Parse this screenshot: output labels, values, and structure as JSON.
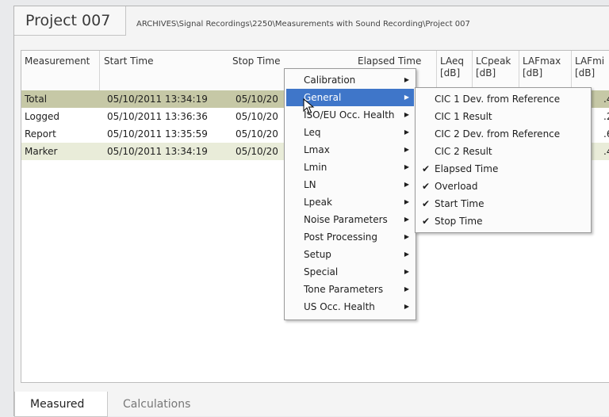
{
  "project": {
    "title": "Project 007",
    "path": "ARCHIVES\\Signal Recordings\\2250\\Measurements with Sound Recording\\Project 007"
  },
  "columns": [
    {
      "label": "Measurement",
      "unit": ""
    },
    {
      "label": "Start Time",
      "unit": ""
    },
    {
      "label": "Stop Time",
      "unit": ""
    },
    {
      "label": "Elapsed Time",
      "unit": ""
    },
    {
      "label": "LAeq",
      "unit": "[dB]"
    },
    {
      "label": "LCpeak",
      "unit": "[dB]"
    },
    {
      "label": "LAFmax",
      "unit": "[dB]"
    },
    {
      "label": "LAFmi",
      "unit": "[dB]"
    }
  ],
  "rows": [
    {
      "measurement": "Total",
      "start": "05/10/2011 13:34:19",
      "stop": "05/10/20",
      "last": ".4"
    },
    {
      "measurement": "Logged",
      "start": "05/10/2011 13:36:36",
      "stop": "05/10/20",
      "last": ".2"
    },
    {
      "measurement": "Report",
      "start": "05/10/2011 13:35:59",
      "stop": "05/10/20",
      "last": ".6"
    },
    {
      "measurement": "Marker",
      "start": "05/10/2011 13:34:19",
      "stop": "05/10/20",
      "last": ".4"
    }
  ],
  "context_menu": [
    {
      "label": "Calibration"
    },
    {
      "label": "General"
    },
    {
      "label": "ISO/EU Occ. Health"
    },
    {
      "label": "Leq"
    },
    {
      "label": "Lmax"
    },
    {
      "label": "Lmin"
    },
    {
      "label": "LN"
    },
    {
      "label": "Lpeak"
    },
    {
      "label": "Noise Parameters"
    },
    {
      "label": "Post Processing"
    },
    {
      "label": "Setup"
    },
    {
      "label": "Special"
    },
    {
      "label": "Tone Parameters"
    },
    {
      "label": "US Occ. Health"
    }
  ],
  "submenu": [
    {
      "label": "CIC 1 Dev. from Reference",
      "checked": false
    },
    {
      "label": "CIC 1 Result",
      "checked": false
    },
    {
      "label": "CIC 2 Dev. from Reference",
      "checked": false
    },
    {
      "label": "CIC 2 Result",
      "checked": false
    },
    {
      "label": "Elapsed Time",
      "checked": true
    },
    {
      "label": "Overload",
      "checked": true
    },
    {
      "label": "Start Time",
      "checked": true
    },
    {
      "label": "Stop Time",
      "checked": true
    }
  ],
  "tabs": {
    "measured": "Measured",
    "calculations": "Calculations"
  },
  "glyphs": {
    "submenu_arrow": "▶",
    "check": "✔",
    "scroll_left": "<",
    "scroll_right": ">"
  },
  "colors": {
    "highlight": "#3f76c9",
    "row_selected": "#c6c8a6",
    "row_alt": "#e9ecd9"
  }
}
